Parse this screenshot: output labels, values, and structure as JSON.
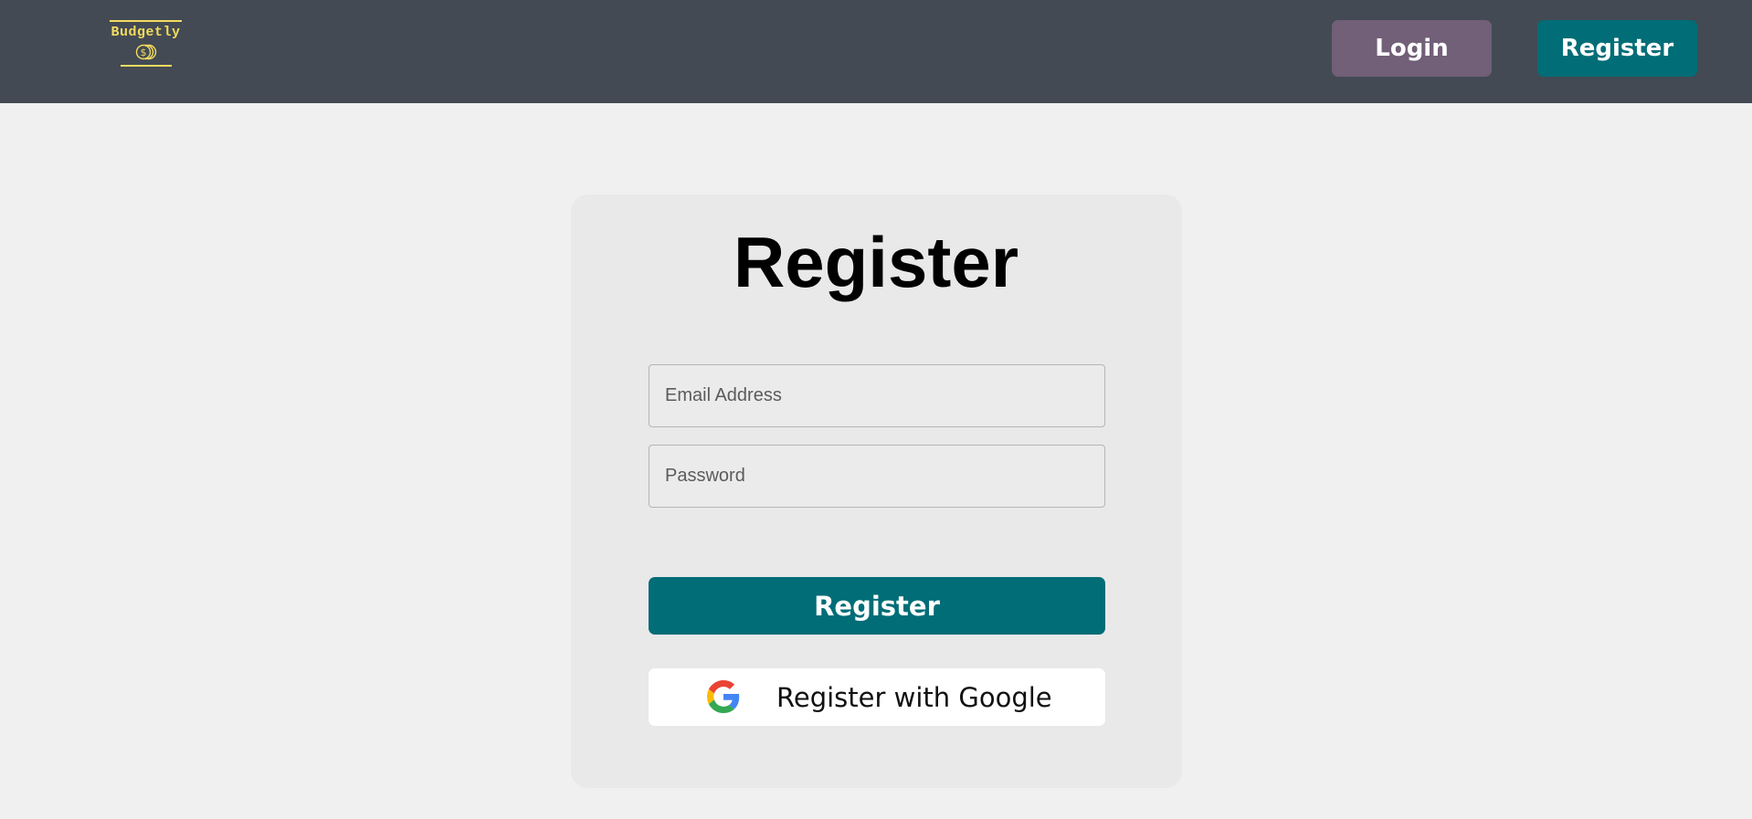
{
  "header": {
    "logo_text": "Budgetly",
    "logo_icon": "coins-icon",
    "login_label": "Login",
    "register_label": "Register"
  },
  "form": {
    "title": "Register",
    "email_placeholder": "Email Address",
    "email_value": "",
    "password_placeholder": "Password",
    "password_value": "",
    "submit_label": "Register",
    "google_label": "Register with Google",
    "google_icon": "google-icon"
  },
  "colors": {
    "navbar": "#434a54",
    "logo_accent": "#f2dc5d",
    "login_button": "#725f78",
    "primary": "#006d77",
    "background": "#f0f0f0",
    "card": "#e9e9e9"
  }
}
